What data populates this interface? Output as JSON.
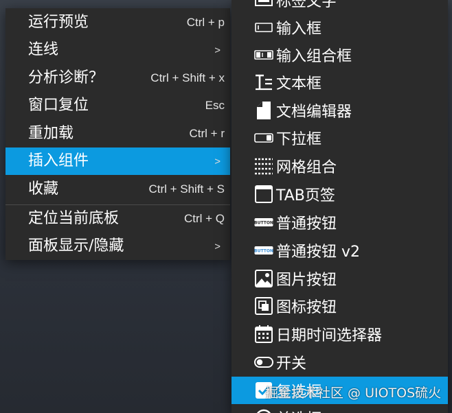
{
  "menu": {
    "items": [
      {
        "label": "运行预览",
        "shortcut": "Ctrl + p"
      },
      {
        "label": "连线",
        "shortcut": ">"
      },
      {
        "label": "分析诊断？",
        "shortcut": "Ctrl + Shift + x"
      },
      {
        "label": "窗口复位",
        "shortcut": "Esc"
      },
      {
        "label": "重加载",
        "shortcut": "Ctrl + r"
      },
      {
        "label": "插入组件",
        "shortcut": ">"
      },
      {
        "label": "收藏",
        "shortcut": "Ctrl + Shift + S"
      },
      {
        "label": "定位当前底板",
        "shortcut": "Ctrl + Q"
      },
      {
        "label": "面板显示/隐藏",
        "shortcut": ">"
      }
    ]
  },
  "submenu": {
    "items": [
      {
        "label": "标签文字",
        "icon": "label-icon"
      },
      {
        "label": "输入框",
        "icon": "input-box-icon"
      },
      {
        "label": "输入组合框",
        "icon": "input-combo-icon"
      },
      {
        "label": "文本框",
        "icon": "textarea-icon"
      },
      {
        "label": "文档编辑器",
        "icon": "document-icon"
      },
      {
        "label": "下拉框",
        "icon": "dropdown-icon"
      },
      {
        "label": "网格组合",
        "icon": "grid-icon"
      },
      {
        "label": "TAB页签",
        "icon": "tab-icon"
      },
      {
        "label": "普通按钮",
        "icon": "button-icon",
        "badge": "BUTTON"
      },
      {
        "label": "普通按钮 v2",
        "icon": "button-v2-icon",
        "badge": "BUTTON"
      },
      {
        "label": "图片按钮",
        "icon": "image-button-icon"
      },
      {
        "label": "图标按钮",
        "icon": "icon-button-icon"
      },
      {
        "label": "日期时间选择器",
        "icon": "calendar-icon"
      },
      {
        "label": "开关",
        "icon": "switch-icon"
      },
      {
        "label": "复选框",
        "icon": "checkbox-icon"
      },
      {
        "label": "单选框",
        "icon": "radio-icon"
      }
    ]
  },
  "watermark": "掘金技术社区 @ UIOTOS硫火",
  "colors": {
    "highlight": "#0c9ae0",
    "menu_bg": "#2b2b2b"
  }
}
